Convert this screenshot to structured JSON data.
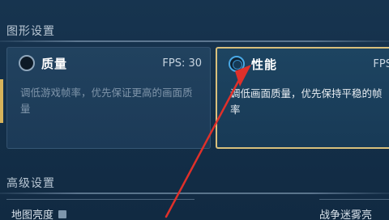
{
  "sections": {
    "graphics_title": "图形设置",
    "advanced_title": "高级设置"
  },
  "cards": {
    "quality": {
      "title": "质量",
      "fps": "FPS: 30",
      "description": "调低游戏帧率，优先保证更高的画面质量",
      "selected": false
    },
    "performance": {
      "title": "性能",
      "fps": "FPS",
      "description": "调低画面质量，优先保持平稳的帧率",
      "selected": true
    }
  },
  "advanced": {
    "map_brightness_label": "地图亮度",
    "fog_label": "战争迷雾亮"
  },
  "colors": {
    "accent_border": "#d9c07c",
    "annotation_arrow": "#e0302a",
    "selected_radio": "#49a9e6"
  },
  "icons": {
    "map_info": "info-icon",
    "radio_selected": "radio-selected-icon",
    "radio_unselected": "radio-unselected-icon"
  }
}
